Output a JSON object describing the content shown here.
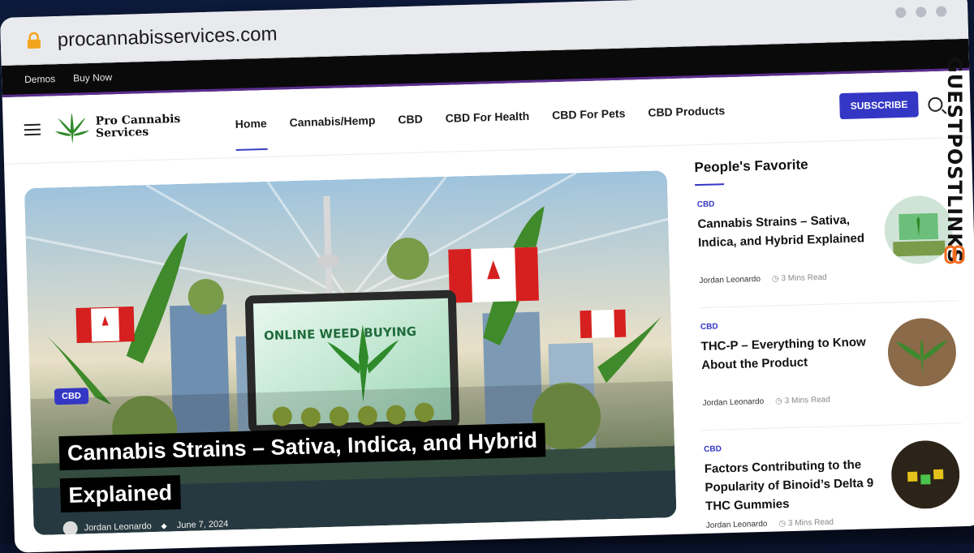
{
  "browser": {
    "url": "procannabisservices.com"
  },
  "topbar": {
    "links": [
      "Demos",
      "Buy Now"
    ]
  },
  "header": {
    "logo_line1": "Pro Cannabis",
    "logo_line2": "Services",
    "nav": [
      "Home",
      "Cannabis/Hemp",
      "CBD",
      "CBD For Health",
      "CBD For Pets",
      "CBD Products"
    ],
    "subscribe_label": "SUBSCRIBE"
  },
  "hero": {
    "category": "CBD",
    "title": "Cannabis Strains – Sativa, Indica, and Hybrid Explained",
    "author": "Jordan Leonardo",
    "date": "June 7, 2024",
    "image_text": "ONLINE WEED BUYING"
  },
  "sidebar": {
    "title": "People's Favorite",
    "posts": [
      {
        "category": "CBD",
        "title": "Cannabis Strains – Sativa, Indica, and Hybrid Explained",
        "author": "Jordan Leonardo",
        "read": "3 Mins Read"
      },
      {
        "category": "CBD",
        "title": "THC-P – Everything to Know About the Product",
        "author": "Jordan Leonardo",
        "read": "3 Mins Read"
      },
      {
        "category": "CBD",
        "title": "Factors Contributing to the Popularity of Binoid’s Delta 9 THC Gummies",
        "author": "Jordan Leonardo",
        "read": "3 Mins Read"
      }
    ]
  },
  "watermark": "GUESTPOSTLINKS"
}
